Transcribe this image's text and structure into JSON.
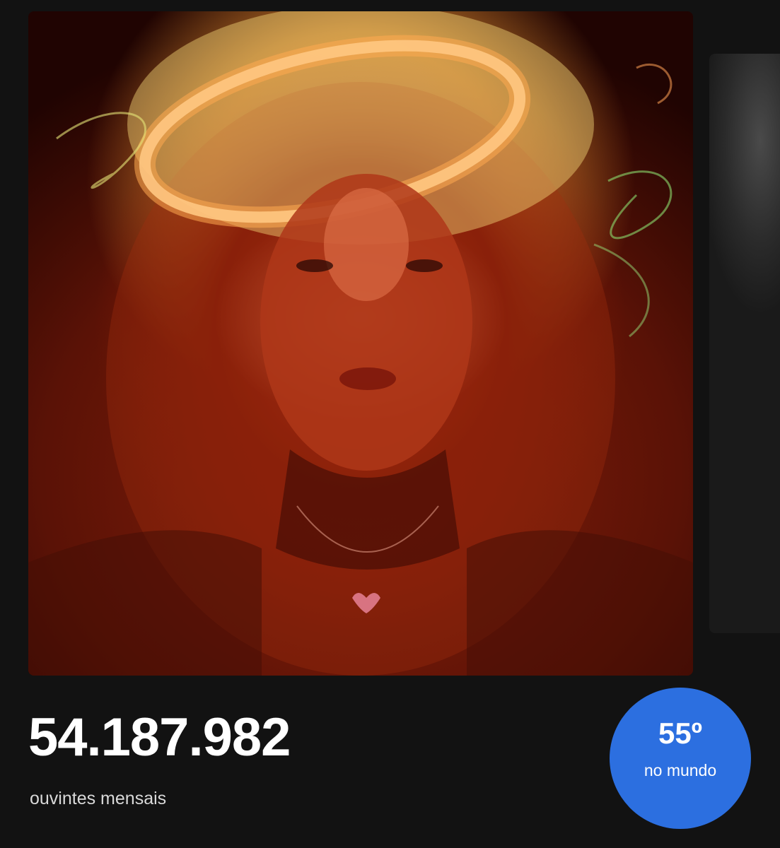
{
  "artist": {
    "image_description": "Artist portrait with warm red/orange light trails and a glowing halo"
  },
  "stats": {
    "monthly_listeners": "54.187.982",
    "monthly_listeners_label": "ouvintes mensais",
    "world_rank": "55º",
    "world_rank_label": "no mundo"
  },
  "colors": {
    "background": "#121212",
    "rank_badge": "#2c6fe0",
    "primary_text": "#ffffff",
    "secondary_text": "#d9d9d9"
  }
}
